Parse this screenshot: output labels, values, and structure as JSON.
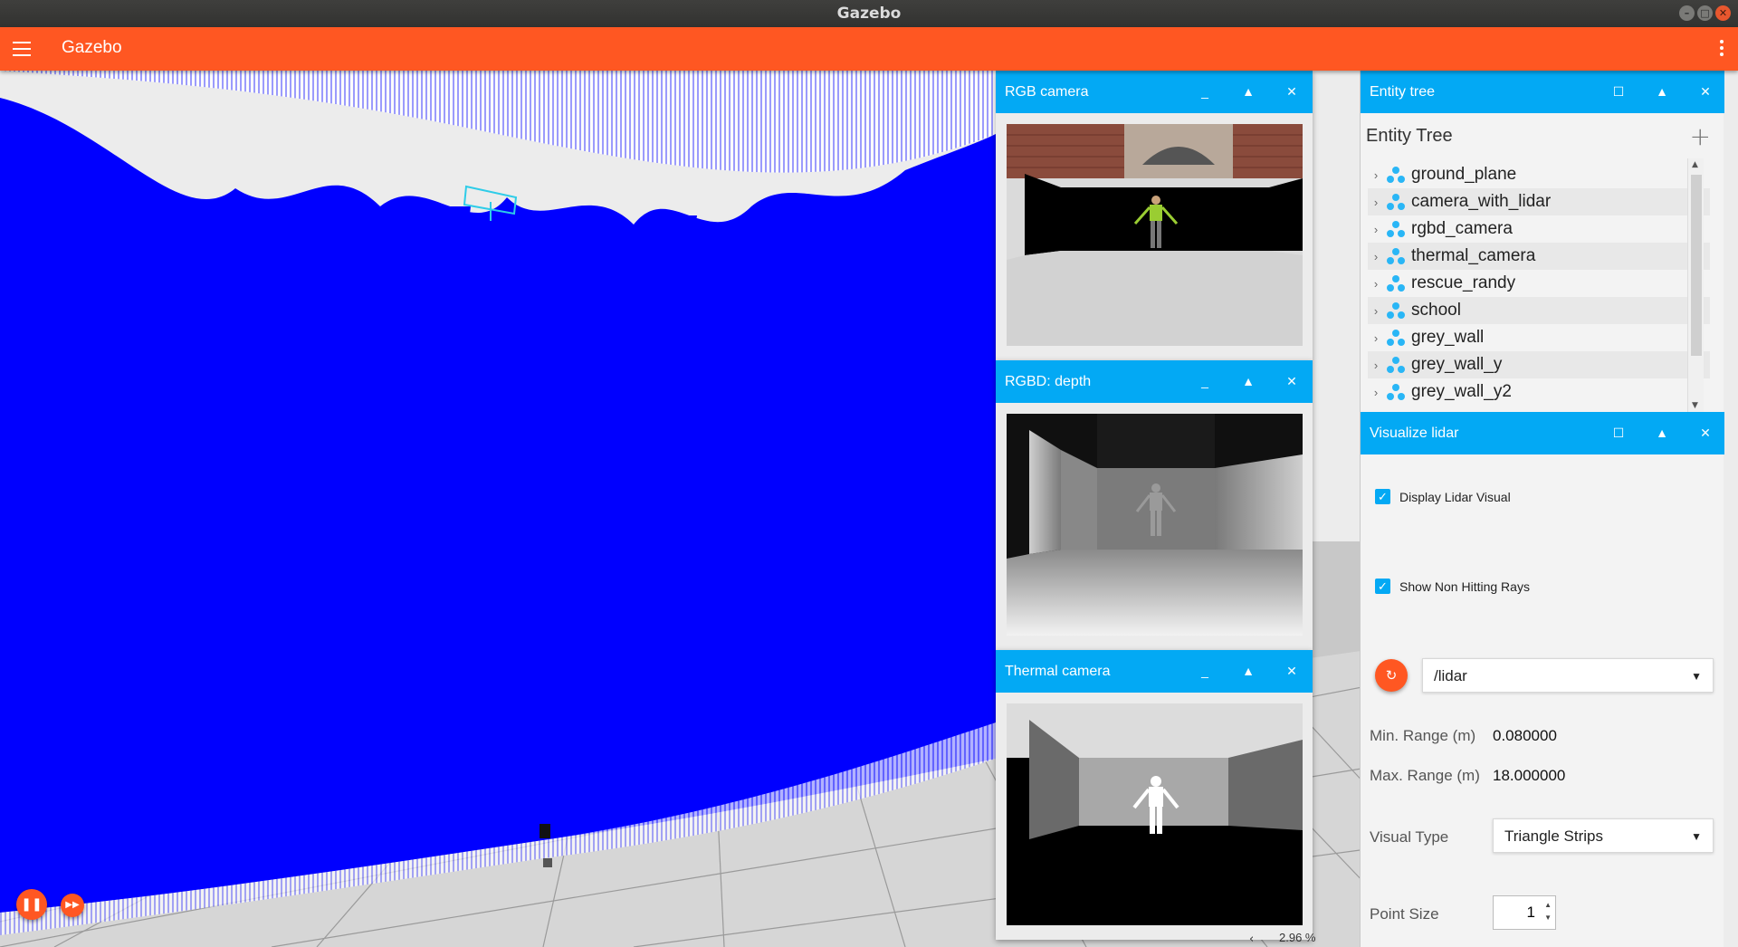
{
  "window": {
    "title": "Gazebo"
  },
  "appbar": {
    "title": "Gazebo"
  },
  "camera_panels": [
    {
      "title": "RGB camera"
    },
    {
      "title": "RGBD: depth"
    },
    {
      "title": "Thermal camera"
    }
  ],
  "entity_tree": {
    "dock_title": "Entity tree",
    "heading": "Entity Tree",
    "items": [
      "ground_plane",
      "camera_with_lidar",
      "rgbd_camera",
      "thermal_camera",
      "rescue_randy",
      "school",
      "grey_wall",
      "grey_wall_y",
      "grey_wall_y2"
    ]
  },
  "lidar": {
    "dock_title": "Visualize lidar",
    "display_visual_label": "Display Lidar Visual",
    "display_visual_checked": true,
    "non_hitting_label": "Show Non Hitting Rays",
    "non_hitting_checked": true,
    "topic": "/lidar",
    "min_range_label": "Min. Range (m)",
    "min_range_value": "0.080000",
    "max_range_label": "Max. Range (m)",
    "max_range_value": "18.000000",
    "visual_type_label": "Visual Type",
    "visual_type_value": "Triangle Strips",
    "point_size_label": "Point Size",
    "point_size_value": "1"
  },
  "status": {
    "rtf": "2.96 %"
  },
  "colors": {
    "accent": "#ff5722",
    "header": "#03a9f4",
    "lidar": "#0000ff"
  },
  "icons": {
    "menu": "hamburger-icon",
    "overflow": "kebab-icon",
    "play": "pause-icon",
    "step": "step-icon",
    "refresh": "refresh-icon"
  }
}
